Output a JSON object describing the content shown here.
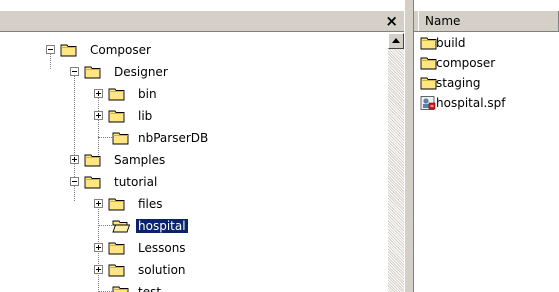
{
  "tree_pane": {
    "close_label": "×",
    "nodes": [
      {
        "label": "Composer"
      },
      {
        "label": "Designer"
      },
      {
        "label": "bin"
      },
      {
        "label": "lib"
      },
      {
        "label": "nbParserDB"
      },
      {
        "label": "Samples"
      },
      {
        "label": "tutorial"
      },
      {
        "label": "files"
      },
      {
        "label": "hospital"
      },
      {
        "label": "Lessons"
      },
      {
        "label": "solution"
      },
      {
        "label": "test"
      }
    ]
  },
  "list_pane": {
    "column_header": "Name",
    "items": [
      {
        "label": "build",
        "icon": "folder-icon"
      },
      {
        "label": "composer",
        "icon": "folder-icon"
      },
      {
        "label": "staging",
        "icon": "folder-icon"
      },
      {
        "label": "hospital.spf",
        "icon": "spf-file-icon"
      }
    ]
  },
  "colors": {
    "selection": "#0a246a",
    "chrome": "#d4d0c8",
    "folder": "#ffe680"
  }
}
